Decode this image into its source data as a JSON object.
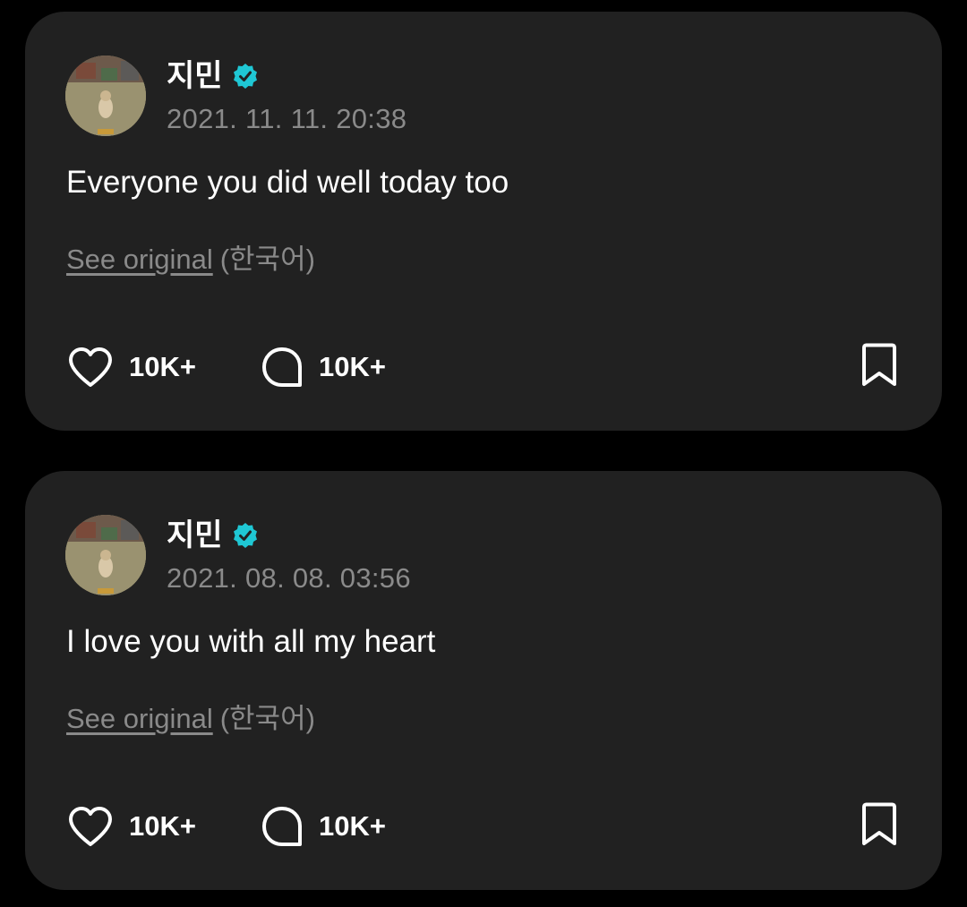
{
  "colors": {
    "background": "#000000",
    "card": "#212121",
    "primary_text": "#ffffff",
    "secondary_text": "#8a8a8a",
    "verified_badge": "#1fc7d4"
  },
  "icons": {
    "verified": "verified-badge-icon",
    "like": "heart-icon",
    "comment": "speech-bubble-icon",
    "bookmark": "bookmark-icon"
  },
  "posts": [
    {
      "author": "지민",
      "timestamp": "2021. 11. 11. 20:38",
      "text": "Everyone you did well today too",
      "see_original_label": "See original",
      "language": "(한국어)",
      "likes": "10K+",
      "comments": "10K+"
    },
    {
      "author": "지민",
      "timestamp": "2021. 08. 08. 03:56",
      "text": "I love you with all my heart",
      "see_original_label": "See original",
      "language": "(한국어)",
      "likes": "10K+",
      "comments": "10K+"
    }
  ]
}
